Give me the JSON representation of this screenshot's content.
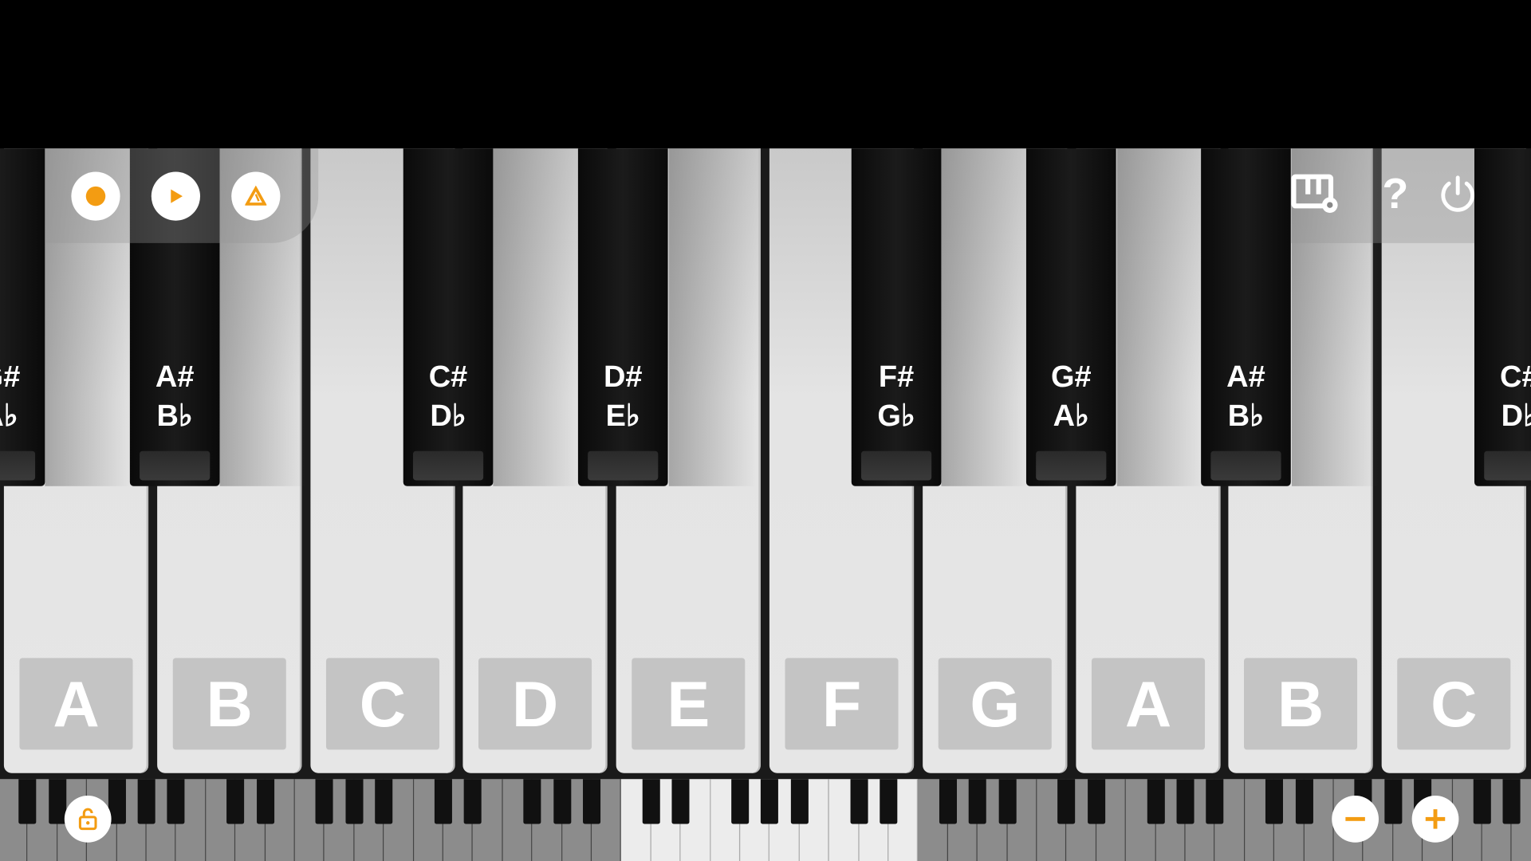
{
  "app": {
    "accent_color": "#f39c12"
  },
  "white_keys": [
    "A",
    "B",
    "C",
    "D",
    "E",
    "F",
    "G",
    "A",
    "B",
    "C"
  ],
  "black_keys": [
    {
      "sharp": "G#",
      "flat": "A♭"
    },
    {
      "sharp": "A#",
      "flat": "B♭"
    },
    {
      "sharp": "C#",
      "flat": "D♭"
    },
    {
      "sharp": "D#",
      "flat": "E♭"
    },
    {
      "sharp": "F#",
      "flat": "G♭"
    },
    {
      "sharp": "G#",
      "flat": "A♭"
    },
    {
      "sharp": "A#",
      "flat": "B♭"
    },
    {
      "sharp": "C#",
      "flat": "D♭"
    }
  ],
  "toolbar_left": {
    "record_icon": "record-icon",
    "play_icon": "play-icon",
    "metronome_icon": "metronome-icon"
  },
  "toolbar_right": {
    "settings_icon": "keyboard-settings-icon",
    "help_label": "?",
    "power_icon": "power-icon"
  },
  "bottom_controls": {
    "lock_icon": "unlock-icon",
    "zoom_out_icon": "minus-icon",
    "zoom_in_icon": "plus-icon"
  }
}
